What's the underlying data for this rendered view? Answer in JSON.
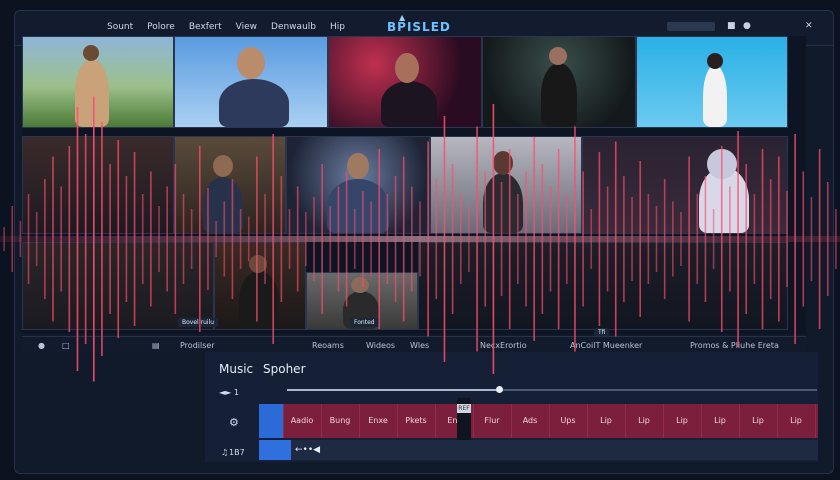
{
  "app": {
    "title": "BPISLED",
    "menu": [
      "Sount",
      "Polore",
      "Bexfert",
      "View",
      "Denwaulb",
      "Hip"
    ]
  },
  "media_grid": {
    "labels": [
      "Bovel ruilu",
      "Fonted",
      "Tfi"
    ]
  },
  "media_tabs": [
    "Prodilser",
    "Reoams",
    "Wideos",
    "Wles",
    "NecxErortio",
    "AnCoilT Mueenker",
    "Promos & Pliuhe Ereta"
  ],
  "panel": {
    "title": "Music",
    "subtitle": "Spoher",
    "timecode": "◄► 1",
    "counter": "1B7",
    "track_cells": [
      "Aadio",
      "Bung",
      "Enxe",
      "Pkets",
      "Ent",
      "Flur",
      "Ads",
      "Ups",
      "Lip",
      "Lip",
      "Lip",
      "Lip",
      "Lip",
      "Lip"
    ],
    "playhead_tag": "REF",
    "clip_glyphs": "←••◀",
    "progress": 0.4
  },
  "colors": {
    "accent": "#2a6bd8",
    "track": "#7b1f3c",
    "waveform": "#ff4d6d",
    "title": "#6ec1ff"
  },
  "waveform": {
    "amplitudes": [
      0.08,
      0.22,
      0.12,
      0.3,
      0.18,
      0.4,
      0.55,
      0.35,
      0.62,
      0.88,
      0.7,
      0.95,
      0.78,
      0.5,
      0.66,
      0.42,
      0.58,
      0.3,
      0.45,
      0.22,
      0.35,
      0.5,
      0.3,
      0.2,
      0.62,
      0.34,
      0.12,
      0.25,
      0.4,
      0.2,
      0.15,
      0.55,
      0.3,
      0.7,
      0.42,
      0.2,
      0.35,
      0.18,
      0.28,
      0.5,
      0.22,
      0.35,
      0.45,
      0.2,
      0.32,
      0.25,
      0.6,
      0.3,
      0.42,
      0.55,
      0.35,
      0.25,
      0.65,
      0.4,
      0.82,
      0.5,
      0.3,
      0.22,
      0.75,
      0.45,
      0.9,
      0.38,
      0.6,
      0.3,
      0.45,
      0.68,
      0.5,
      0.35,
      0.6,
      0.3,
      0.75,
      0.45,
      0.2,
      0.58,
      0.35,
      0.65,
      0.42,
      0.28,
      0.52,
      0.3,
      0.22,
      0.4,
      0.25,
      0.18,
      0.55,
      0.3,
      0.42,
      0.2,
      0.62,
      0.35,
      0.72,
      0.5,
      0.3,
      0.6,
      0.4,
      0.55,
      0.32,
      0.7,
      0.45,
      0.28,
      0.6,
      0.38,
      0.2
    ]
  }
}
